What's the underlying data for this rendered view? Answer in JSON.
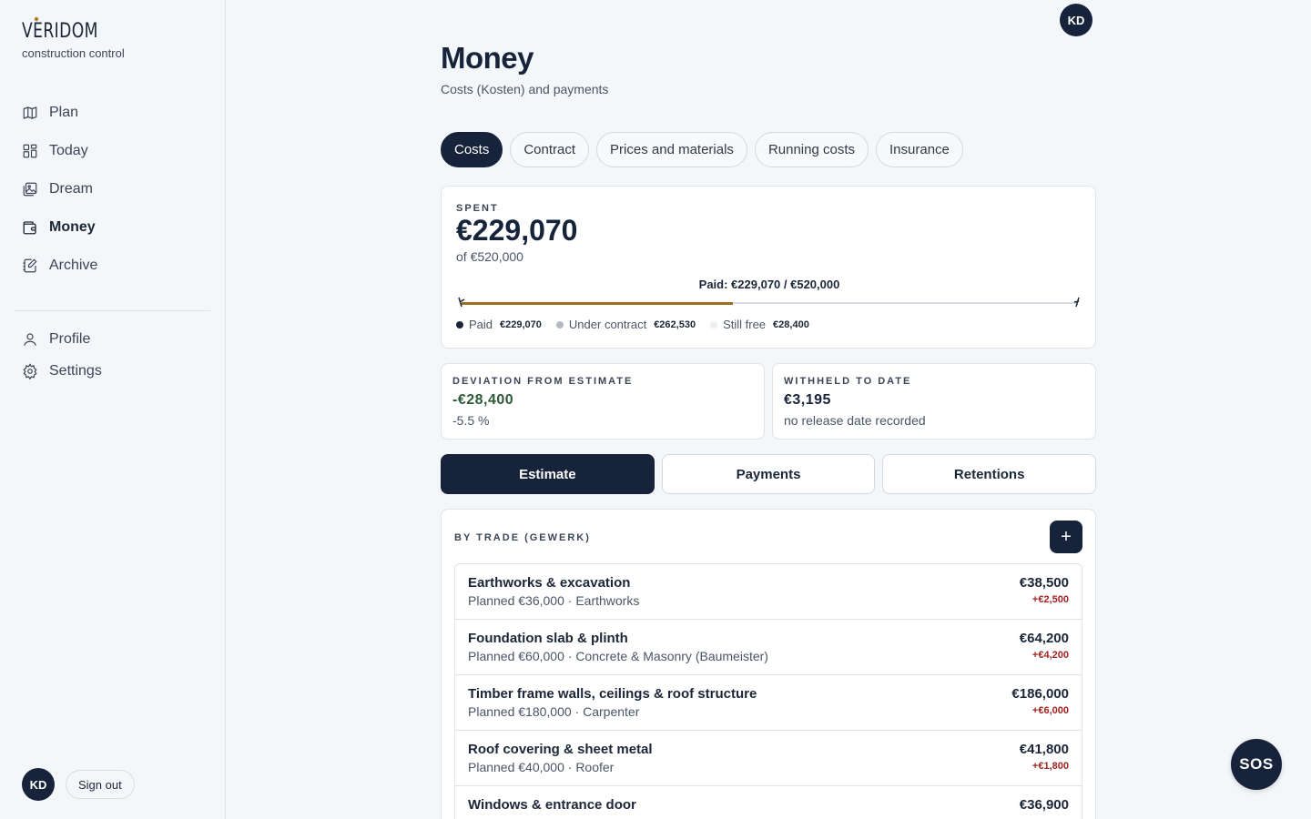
{
  "brand": {
    "name": "VERIDOM",
    "tagline": "construction control"
  },
  "nav": [
    {
      "label": "Plan",
      "icon": "map-icon"
    },
    {
      "label": "Today",
      "icon": "dashboard-icon"
    },
    {
      "label": "Dream",
      "icon": "image-icon"
    },
    {
      "label": "Money",
      "icon": "wallet-icon",
      "active": true
    },
    {
      "label": "Archive",
      "icon": "edit-icon"
    }
  ],
  "nav_secondary": [
    {
      "label": "Profile",
      "icon": "user-icon"
    },
    {
      "label": "Settings",
      "icon": "gear-icon"
    }
  ],
  "user": {
    "initials": "KD",
    "signout_label": "Sign out"
  },
  "page": {
    "title": "Money",
    "subtitle": "Costs (Kosten) and payments"
  },
  "tabs": [
    {
      "label": "Costs",
      "active": true
    },
    {
      "label": "Contract"
    },
    {
      "label": "Prices and materials"
    },
    {
      "label": "Running costs"
    },
    {
      "label": "Insurance"
    }
  ],
  "spent": {
    "label": "SPENT",
    "value": "€229,070",
    "of": "of €520,000",
    "bar_caption": "Paid: €229,070 / €520,000",
    "paid_fraction": 0.4405,
    "legend": [
      {
        "label": "Paid",
        "value": "€229,070",
        "color": "#1b2638"
      },
      {
        "label": "Under contract",
        "value": "€262,530",
        "color": "#b5b9bf"
      },
      {
        "label": "Still free",
        "value": "€28,400",
        "color": "#eceef1"
      }
    ],
    "bar_color": "#9a6e22"
  },
  "deviation": {
    "label": "DEVIATION FROM ESTIMATE",
    "value": "-€28,400",
    "sub": "-5.5 %"
  },
  "withheld": {
    "label": "WITHHELD TO DATE",
    "value": "€3,195",
    "sub": "no release date recorded"
  },
  "segments": [
    {
      "label": "Estimate",
      "active": true
    },
    {
      "label": "Payments"
    },
    {
      "label": "Retentions"
    }
  ],
  "trades": {
    "label": "BY TRADE (GEWERK)",
    "add_label": "+",
    "rows": [
      {
        "name": "Earthworks & excavation",
        "meta": "Planned €36,000 · Earthworks",
        "amount": "€38,500",
        "diff": "+€2,500"
      },
      {
        "name": "Foundation slab & plinth",
        "meta": "Planned €60,000 · Concrete & Masonry (Baumeister)",
        "amount": "€64,200",
        "diff": "+€4,200"
      },
      {
        "name": "Timber frame walls, ceilings & roof structure",
        "meta": "Planned €180,000 · Carpenter",
        "amount": "€186,000",
        "diff": "+€6,000"
      },
      {
        "name": "Roof covering & sheet metal",
        "meta": "Planned €40,000 · Roofer",
        "amount": "€41,800",
        "diff": "+€1,800"
      },
      {
        "name": "Windows & entrance door",
        "meta": "",
        "amount": "€36,900",
        "diff": ""
      }
    ]
  },
  "sos_label": "SOS"
}
